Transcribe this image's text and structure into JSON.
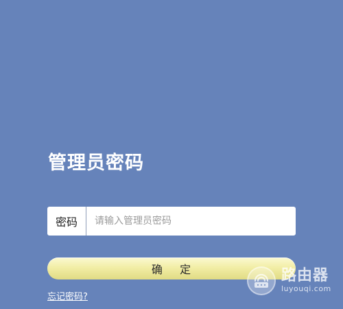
{
  "page": {
    "title": "管理员密码"
  },
  "password": {
    "label": "密码",
    "placeholder": "请输入管理员密码",
    "value": ""
  },
  "actions": {
    "confirm_label": "确    定",
    "forgot_label": "忘记密码?"
  },
  "watermark": {
    "text_cn": "路由器",
    "text_en": "luyouqi.com",
    "icon": "router-logo-icon"
  },
  "colors": {
    "background": "#6683ba",
    "button_gradient_top": "#fbf9d2",
    "button_gradient_bottom": "#e1db84"
  }
}
